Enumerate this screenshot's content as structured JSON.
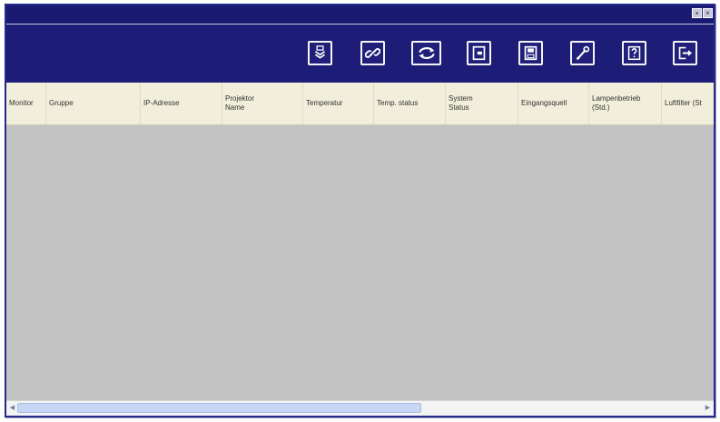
{
  "window": {
    "title": ""
  },
  "toolbar": {
    "buttons": [
      {
        "name": "download-icon"
      },
      {
        "name": "link-icon"
      },
      {
        "name": "refresh-icon"
      },
      {
        "name": "input-source-icon"
      },
      {
        "name": "save-icon"
      },
      {
        "name": "wrench-icon"
      },
      {
        "name": "help-icon"
      },
      {
        "name": "exit-icon"
      }
    ]
  },
  "table": {
    "columns": [
      "Monitor",
      "Gruppe",
      "IP-Adresse",
      "Projektor\nName",
      "Temperatur",
      "Temp. status",
      "System\nStatus",
      "Eingangsquell",
      "Lampenbetrieb\n(Std.)",
      "Luftfilter (St"
    ],
    "rows": []
  },
  "colors": {
    "window_frame": "#1d1d78",
    "header_bg": "#f1eedb",
    "grid_bg": "#c3c3c3"
  }
}
